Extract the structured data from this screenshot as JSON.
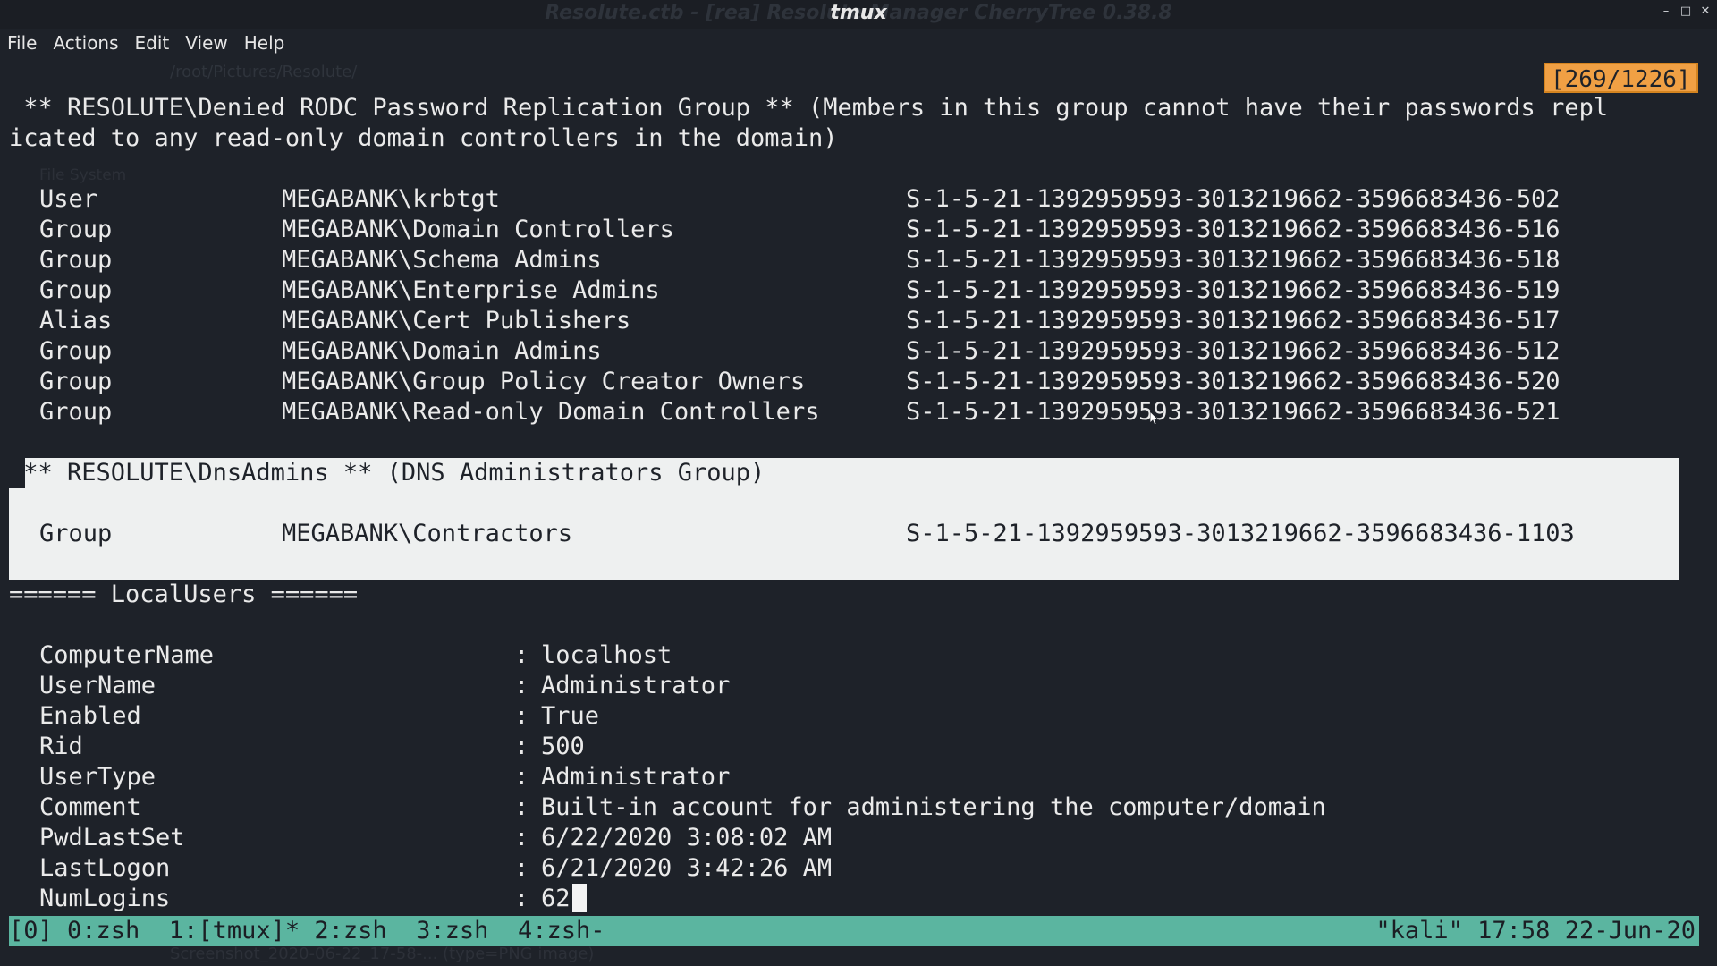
{
  "window": {
    "title": "tmux",
    "background_title": "Resolute.ctb - [rea] Resolute Manager CherryTree 0.38.8",
    "controls": [
      "minimize",
      "maximize",
      "close"
    ]
  },
  "menu": [
    "File",
    "Actions",
    "Edit",
    "View",
    "Help"
  ],
  "background_ghost": {
    "path": "/root/Pictures/Resolute/",
    "filesystem_label": "File System",
    "footer": "Screenshot_2020-06-22_17-58-... (type=PNG image)"
  },
  "scroll_position": "[269/1226]",
  "terminal": {
    "rodc_header_1": " ** RESOLUTE\\Denied RODC Password Replication Group ** (Members in this group cannot have their passwords repl",
    "rodc_header_2": "icated to any read-only domain controllers in the domain)",
    "rodc_members": [
      {
        "type": "User",
        "name": "MEGABANK\\krbtgt",
        "sid": "S-1-5-21-1392959593-3013219662-3596683436-502"
      },
      {
        "type": "Group",
        "name": "MEGABANK\\Domain Controllers",
        "sid": "S-1-5-21-1392959593-3013219662-3596683436-516"
      },
      {
        "type": "Group",
        "name": "MEGABANK\\Schema Admins",
        "sid": "S-1-5-21-1392959593-3013219662-3596683436-518"
      },
      {
        "type": "Group",
        "name": "MEGABANK\\Enterprise Admins",
        "sid": "S-1-5-21-1392959593-3013219662-3596683436-519"
      },
      {
        "type": "Alias",
        "name": "MEGABANK\\Cert Publishers",
        "sid": "S-1-5-21-1392959593-3013219662-3596683436-517"
      },
      {
        "type": "Group",
        "name": "MEGABANK\\Domain Admins",
        "sid": "S-1-5-21-1392959593-3013219662-3596683436-512"
      },
      {
        "type": "Group",
        "name": "MEGABANK\\Group Policy Creator Owners",
        "sid": "S-1-5-21-1392959593-3013219662-3596683436-520"
      },
      {
        "type": "Group",
        "name": "MEGABANK\\Read-only Domain Controllers",
        "sid": "S-1-5-21-1392959593-3013219662-3596683436-521"
      }
    ],
    "dns_header": " ** RESOLUTE\\DnsAdmins ** (DNS Administrators Group)",
    "dns_members": [
      {
        "type": "Group",
        "name": "MEGABANK\\Contractors",
        "sid": "S-1-5-21-1392959593-3013219662-3596683436-1103"
      }
    ],
    "local_users_header": "====== LocalUsers ======",
    "local_user_fields": [
      {
        "key": "ComputerName",
        "value": "localhost"
      },
      {
        "key": "UserName",
        "value": "Administrator"
      },
      {
        "key": "Enabled",
        "value": "True"
      },
      {
        "key": "Rid",
        "value": "500"
      },
      {
        "key": "UserType",
        "value": "Administrator"
      },
      {
        "key": "Comment",
        "value": "Built-in account for administering the computer/domain"
      },
      {
        "key": "PwdLastSet",
        "value": "6/22/2020 3:08:02 AM"
      },
      {
        "key": "LastLogon",
        "value": "6/21/2020 3:42:26 AM"
      },
      {
        "key": "NumLogins",
        "value": "62"
      }
    ],
    "colon": ":"
  },
  "statusbar": {
    "left": "[0] 0:zsh  1:[tmux]* 2:zsh  3:zsh  4:zsh-",
    "right": "\"kali\" 17:58 22-Jun-20",
    "color": "#5bb5a0"
  },
  "highlight_color": "#eef0f0",
  "indicator_color": "#f0a044"
}
